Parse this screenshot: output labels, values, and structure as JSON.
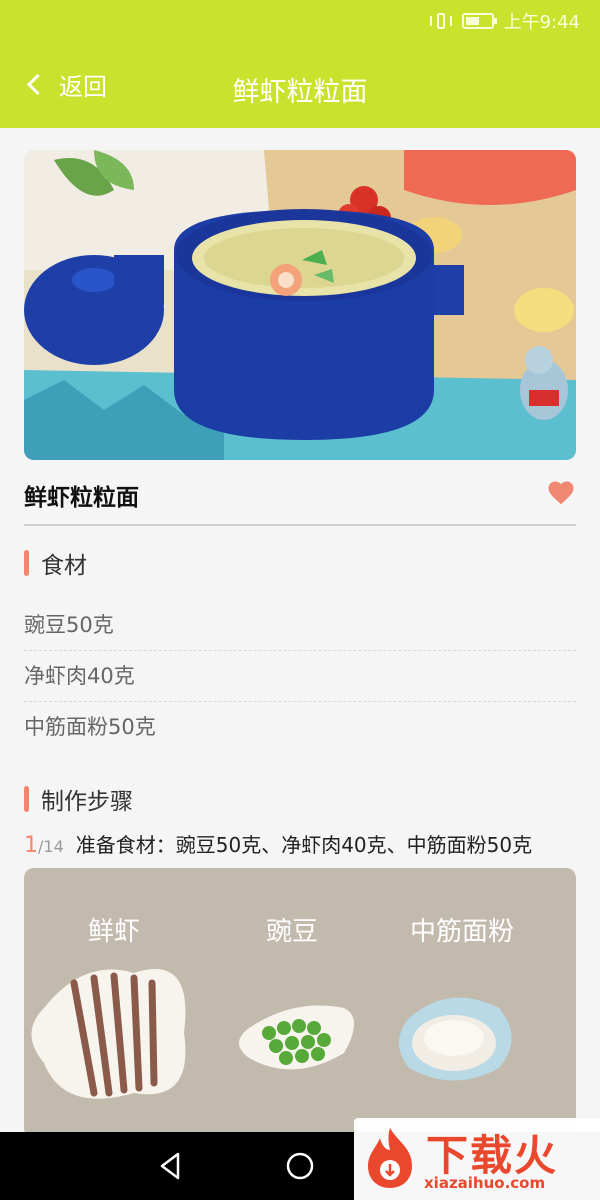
{
  "status_bar": {
    "time": "上午9:44",
    "battery_level": 0.55
  },
  "header": {
    "back_label": "返回",
    "title": "鲜虾粒粒面"
  },
  "recipe": {
    "name": "鲜虾粒粒面",
    "favorited": true
  },
  "ingredients_section": {
    "title": "食材",
    "items": [
      "豌豆50克",
      "净虾肉40克",
      "中筋面粉50克"
    ]
  },
  "steps_section": {
    "title": "制作步骤",
    "current": "1",
    "total": "/14",
    "text": "准备食材：豌豆50克、净虾肉40克、中筋面粉50克",
    "image_labels": [
      "鲜虾",
      "豌豆",
      "中筋面粉"
    ]
  },
  "watermark": {
    "brand": "下载火",
    "url": "xiazaihuo.com"
  },
  "colors": {
    "accent": "#c9e22e",
    "highlight": "#f4866e",
    "heart": "#f08770"
  }
}
